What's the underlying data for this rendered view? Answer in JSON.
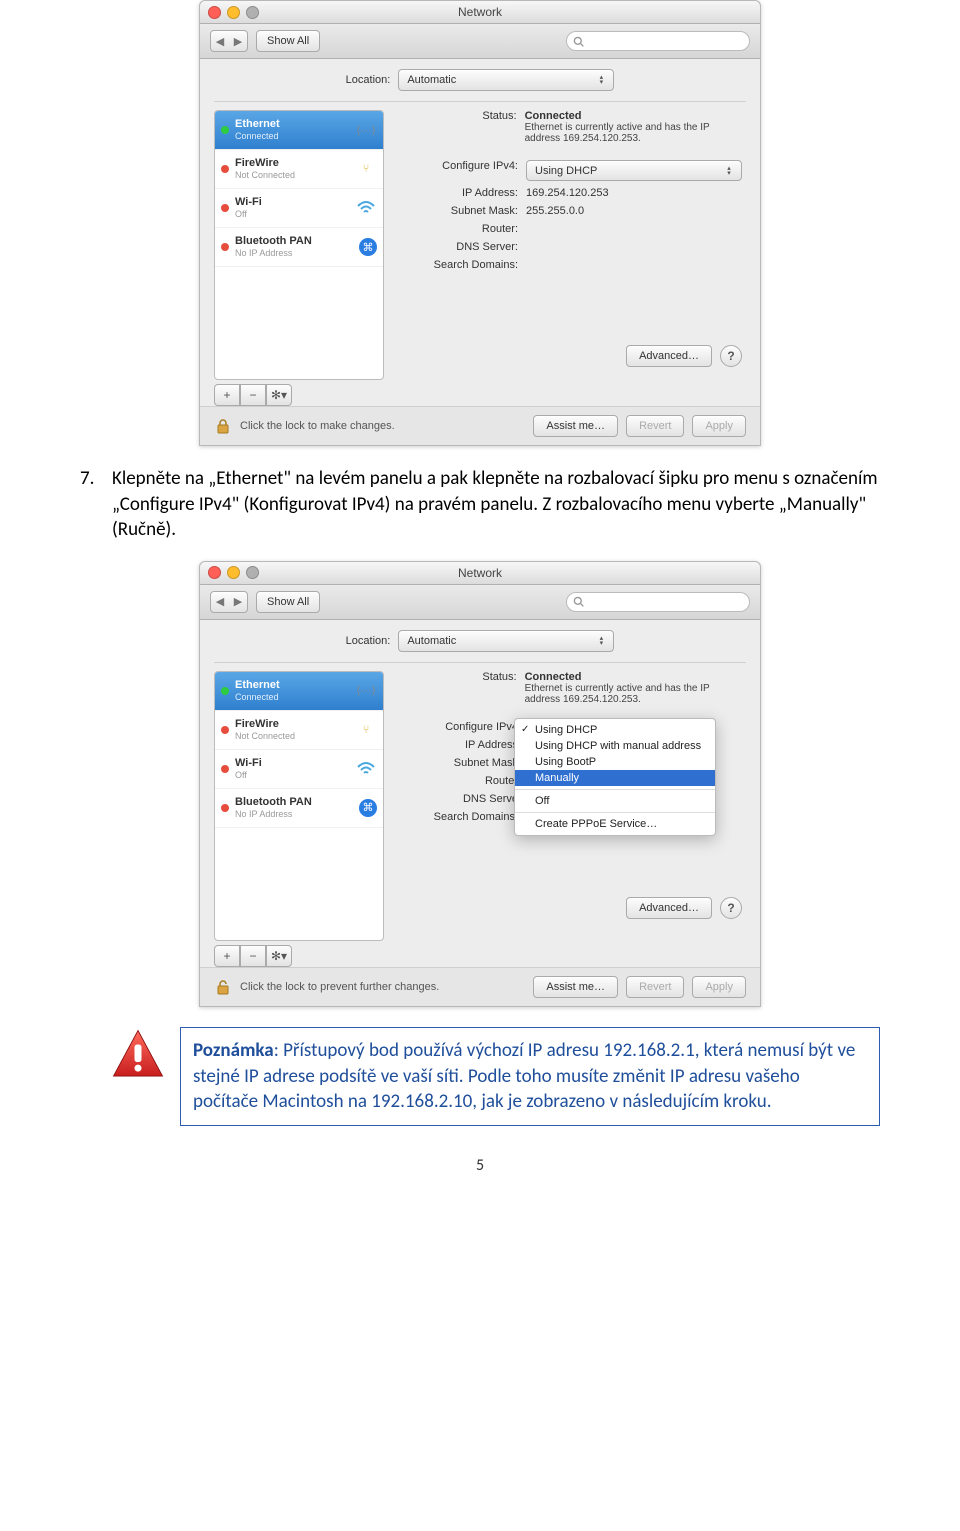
{
  "win1": {
    "title": "Network",
    "showAll": "Show All",
    "locationLabel": "Location:",
    "locationValue": "Automatic",
    "sidebar": [
      {
        "name": "Ethernet",
        "sub": "Connected",
        "dot": "green"
      },
      {
        "name": "FireWire",
        "sub": "Not Connected",
        "dot": "red"
      },
      {
        "name": "Wi-Fi",
        "sub": "Off",
        "dot": "red"
      },
      {
        "name": "Bluetooth PAN",
        "sub": "No IP Address",
        "dot": "red"
      }
    ],
    "statusLabel": "Status:",
    "statusValue": "Connected",
    "statusDesc": "Ethernet is currently active and has the IP address 169.254.120.253.",
    "cfgLabel": "Configure IPv4:",
    "cfgValue": "Using DHCP",
    "ipLabel": "IP Address:",
    "ipValue": "169.254.120.253",
    "maskLabel": "Subnet Mask:",
    "maskValue": "255.255.0.0",
    "routerLabel": "Router:",
    "dnsLabel": "DNS Server:",
    "searchLabel": "Search Domains:",
    "advanced": "Advanced…",
    "lockText": "Click the lock to make changes.",
    "assist": "Assist me…",
    "revert": "Revert",
    "apply": "Apply"
  },
  "para1": {
    "num": "7.",
    "text": "Klepněte na „Ethernet\" na levém panelu a pak klepněte na rozbalovací šipku pro menu s označením „Configure IPv4\" (Konfigurovat IPv4) na pravém panelu. Z rozbalovacího menu vyberte „Manually\" (Ručně)."
  },
  "win2": {
    "title": "Network",
    "showAll": "Show All",
    "locationLabel": "Location:",
    "locationValue": "Automatic",
    "sidebar": [
      {
        "name": "Ethernet",
        "sub": "Connected",
        "dot": "green"
      },
      {
        "name": "FireWire",
        "sub": "Not Connected",
        "dot": "red"
      },
      {
        "name": "Wi-Fi",
        "sub": "Off",
        "dot": "red"
      },
      {
        "name": "Bluetooth PAN",
        "sub": "No IP Address",
        "dot": "red"
      }
    ],
    "statusLabel": "Status:",
    "statusValue": "Connected",
    "statusDesc": "Ethernet is currently active and has the IP address 169.254.120.253.",
    "cfgLabel": "Configure IPv4",
    "ipLabel": "IP Address",
    "maskLabel": "Subnet Mask",
    "routerLabel": "Router",
    "dnsLabel": "DNS Serve",
    "searchLabel": "Search Domains:",
    "menu": {
      "i0": "Using DHCP",
      "i1": "Using DHCP with manual address",
      "i2": "Using BootP",
      "i3": "Manually",
      "i4": "Off",
      "i5": "Create PPPoE Service…"
    },
    "advanced": "Advanced…",
    "lockText": "Click the lock to prevent further changes.",
    "assist": "Assist me…",
    "revert": "Revert",
    "apply": "Apply"
  },
  "note": {
    "label": "Poznámka",
    "text": ": Přístupový bod používá výchozí IP adresu 192.168.2.1, která nemusí být ve stejné IP adrese podsítě ve vaší síti. Podle toho musíte změnit IP adresu vašeho počítače Macintosh na 192.168.2.10, jak je zobrazeno v následujícím kroku."
  },
  "pageNumber": "5"
}
